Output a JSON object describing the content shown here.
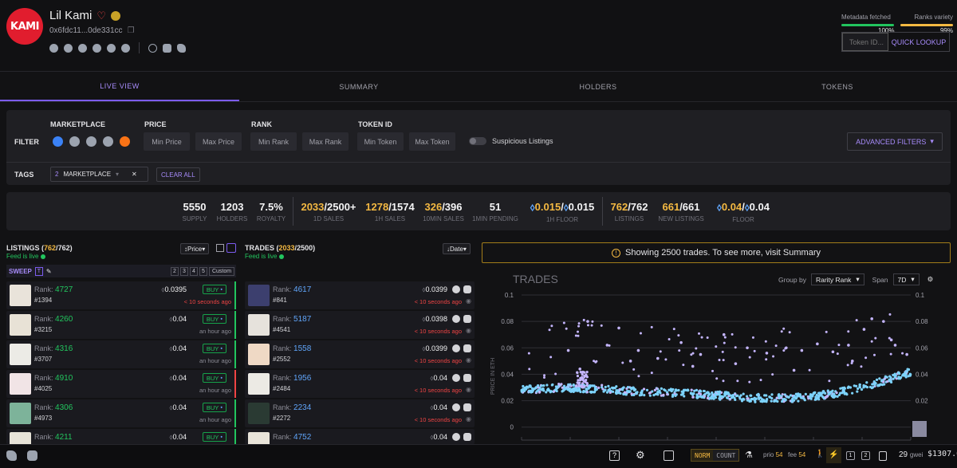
{
  "collection": {
    "logo_text": "KAMI",
    "name": "Lil Kami",
    "address": "0x6fdc11...0de331cc"
  },
  "header": {
    "metadata_label": "Metadata fetched",
    "metadata_pct": "100%",
    "ranks_label": "Ranks variety",
    "ranks_pct": "99%",
    "token_placeholder": "Token ID...",
    "quick_lookup": "QUICK LOOKUP"
  },
  "tabs": [
    "LIVE VIEW",
    "SUMMARY",
    "HOLDERS",
    "TOKENS"
  ],
  "filter": {
    "title": "FILTER",
    "marketplace_label": "MARKETPLACE",
    "price_label": "PRICE",
    "rank_label": "RANK",
    "token_label": "TOKEN ID",
    "min_price": "Min Price",
    "max_price": "Max Price",
    "min_rank": "Min Rank",
    "max_rank": "Max Rank",
    "min_token": "Min Token",
    "max_token": "Max Token",
    "suspicious": "Suspicious Listings",
    "advanced": "ADVANCED FILTERS",
    "tags_label": "TAGS",
    "tag_count": "2",
    "tag_name": "MARKETPLACE",
    "clear_all": "CLEAR ALL"
  },
  "stats": {
    "supply": "5550",
    "supply_l": "SUPPLY",
    "holders": "1203",
    "holders_l": "HOLDERS",
    "royalty": "7.5%",
    "royalty_l": "ROYALTY",
    "sales1d_a": "2033",
    "sales1d_b": "/2500+",
    "sales1d_l": "1D SALES",
    "sales1h_a": "1278",
    "sales1h_b": "/1574",
    "sales1h_l": "1H SALES",
    "sales10_a": "326",
    "sales10_b": "/396",
    "sales10_l": "10MIN SALES",
    "pending": "51",
    "pending_l": "1MIN PENDING",
    "floor1h_a": "0.015",
    "floor1h_b": "0.015",
    "floor1h_l": "1H FLOOR",
    "listings_a": "762",
    "listings_b": "/762",
    "listings_l": "LISTINGS",
    "newlist_a": "661",
    "newlist_b": "/661",
    "newlist_l": "NEW LISTINGS",
    "floor_a": "0.04",
    "floor_b": "0.04",
    "floor_l": "FLOOR"
  },
  "listings": {
    "title": "LISTINGS",
    "count_a": "762",
    "count_b": "762",
    "live": "Feed is live",
    "sort": "Price",
    "sweep": "SWEEP",
    "sweep_t": "T",
    "sweep_nums": [
      "2",
      "3",
      "4",
      "5"
    ],
    "custom": "Custom",
    "items": [
      {
        "rank": "4727",
        "id": "#1394",
        "price": "0.0395",
        "age": "< 10 seconds ago",
        "buy": "BUY",
        "bg": "#e9e3da",
        "edge": "#22c55e"
      },
      {
        "rank": "4260",
        "id": "#3215",
        "price": "0.04",
        "age": "an hour ago",
        "buy": "BUY",
        "bg": "#e8e2d6",
        "edge": "#22c55e"
      },
      {
        "rank": "4316",
        "id": "#3707",
        "price": "0.04",
        "age": "an hour ago",
        "buy": "BUY",
        "bg": "#ecebe6",
        "edge": "#22c55e"
      },
      {
        "rank": "4910",
        "id": "#4025",
        "price": "0.04",
        "age": "an hour ago",
        "buy": "BUY",
        "bg": "#f1e4e6",
        "edge": "#ef4444"
      },
      {
        "rank": "4306",
        "id": "#4973",
        "price": "0.04",
        "age": "an hour ago",
        "buy": "BUY",
        "bg": "#7db39a",
        "edge": "#22c55e"
      },
      {
        "rank": "4211",
        "id": "",
        "price": "0.04",
        "age": "",
        "buy": "BUY",
        "bg": "#e7e3d8",
        "edge": "#22c55e"
      }
    ]
  },
  "trades": {
    "title": "TRADES",
    "count_a": "2033",
    "count_b": "2500",
    "live": "Feed is live",
    "sort": "Date",
    "items": [
      {
        "rank": "4617",
        "id": "#841",
        "price": "0.0399",
        "age": "< 10 seconds ago",
        "bg": "#3c3f6e"
      },
      {
        "rank": "5187",
        "id": "#4541",
        "price": "0.0398",
        "age": "< 10 seconds ago",
        "bg": "#e6e2dc"
      },
      {
        "rank": "1558",
        "id": "#2552",
        "price": "0.0399",
        "age": "< 10 seconds ago",
        "bg": "#efd9c5"
      },
      {
        "rank": "1956",
        "id": "#2484",
        "price": "0.04",
        "age": "< 10 seconds ago",
        "bg": "#eceae4"
      },
      {
        "rank": "2234",
        "id": "#2272",
        "price": "0.04",
        "age": "< 10 seconds ago",
        "bg": "#2a3a33"
      },
      {
        "rank": "4752",
        "id": "",
        "price": "0.04",
        "age": "",
        "bg": "#e9e4d9"
      }
    ]
  },
  "chart_notice": "Showing 2500 trades. To see more, visit Summary",
  "chart_controls": {
    "group_by_label": "Group by",
    "group_by_value": "Rarity Rank",
    "span_label": "Span",
    "span_value": "7D"
  },
  "chart_data": {
    "type": "scatter",
    "title": "TRADES",
    "ylabel": "PRICE IN ETH",
    "ylim": [
      -0.005,
      0.1
    ],
    "yticks": [
      "0.1",
      "0.08",
      "0.06",
      "0.04",
      "0.02",
      "0"
    ],
    "grid": true,
    "series": [
      {
        "name": "",
        "color": "#7dd3fc",
        "description_trend": "dense band ~0.028 declining to ~0.02 mid-span then rising to ~0.042"
      },
      {
        "name": "",
        "color": "#c4b5fd"
      }
    ],
    "trend_x": [
      0,
      0.1,
      0.2,
      0.3,
      0.4,
      0.5,
      0.6,
      0.7,
      0.8,
      0.9,
      1.0
    ],
    "trend_y": [
      0.028,
      0.03,
      0.029,
      0.027,
      0.026,
      0.024,
      0.022,
      0.022,
      0.025,
      0.032,
      0.042
    ],
    "outlier_x": [
      0.12,
      0.17,
      0.22,
      0.25,
      0.3,
      0.35,
      0.41,
      0.46,
      0.52,
      0.58,
      0.63,
      0.68,
      0.72,
      0.76,
      0.8,
      0.84,
      0.88,
      0.9,
      0.93,
      0.96,
      0.99,
      0.15,
      0.28,
      0.44,
      0.55,
      0.7,
      0.85,
      0.95
    ],
    "outlier_y": [
      0.058,
      0.08,
      0.062,
      0.075,
      0.058,
      0.052,
      0.064,
      0.055,
      0.07,
      0.06,
      0.056,
      0.06,
      0.058,
      0.063,
      0.057,
      0.062,
      0.074,
      0.082,
      0.08,
      0.062,
      0.055,
      0.044,
      0.05,
      0.046,
      0.048,
      0.043,
      0.05,
      0.066
    ]
  },
  "footer": {
    "norm": "NORM",
    "count": "COUNT",
    "prio_label": "prio",
    "prio": "54",
    "fee_label": "fee",
    "fee": "54",
    "gwei": "29",
    "gwei_label": "gwei",
    "eth_price": "$1307.0"
  }
}
